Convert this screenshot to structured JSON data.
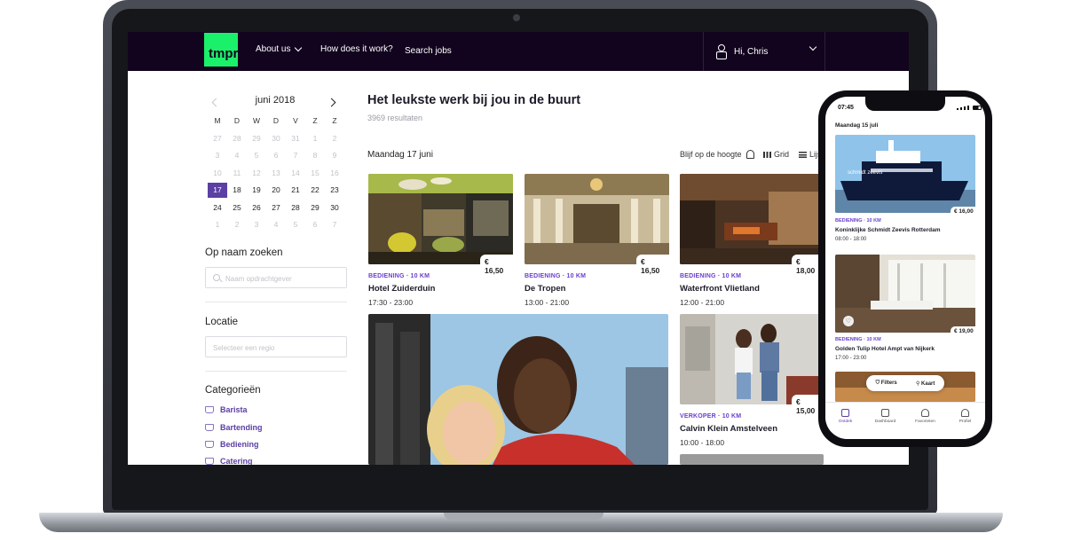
{
  "navbar": {
    "logo": "tmpr",
    "links": [
      {
        "label": "About us",
        "has_dropdown": true
      },
      {
        "label": "How does it work?",
        "has_dropdown": false
      },
      {
        "label": "Search jobs",
        "has_dropdown": false
      }
    ],
    "user_greeting": "Hi, Chris"
  },
  "calendar": {
    "month": "juni 2018",
    "weekdays": [
      "M",
      "D",
      "W",
      "D",
      "V",
      "Z",
      "Z"
    ],
    "rows": [
      [
        "27",
        "28",
        "29",
        "30",
        "31",
        "1",
        "2"
      ],
      [
        "3",
        "4",
        "5",
        "6",
        "7",
        "8",
        "9"
      ],
      [
        "10",
        "11",
        "12",
        "13",
        "14",
        "15",
        "16"
      ],
      [
        "17",
        "18",
        "19",
        "20",
        "21",
        "22",
        "23"
      ],
      [
        "24",
        "25",
        "26",
        "27",
        "28",
        "29",
        "30"
      ],
      [
        "1",
        "2",
        "3",
        "4",
        "5",
        "6",
        "7"
      ]
    ],
    "selected": "17"
  },
  "sidebar": {
    "name_search_title": "Op naam zoeken",
    "name_search_placeholder": "Naam opdrachtgever",
    "location_title": "Locatie",
    "location_placeholder": "Selecteer een regio",
    "categories_title": "Categorieën",
    "categories": [
      "Barista",
      "Bartending",
      "Bediening",
      "Catering"
    ]
  },
  "main": {
    "title": "Het leukste werk bij jou in de buurt",
    "result_count": "3969 resultaten",
    "date_heading": "Maandag 17 juni",
    "alert_label": "Blijf op de hoogte",
    "grid_label": "Grid",
    "list_label": "Lijst",
    "jobs": [
      {
        "category": "BEDIENING · 10 KM",
        "name": "Hotel Zuiderduin",
        "time": "17:30 - 23:00",
        "price": "€ 16,50"
      },
      {
        "category": "BEDIENING · 10 KM",
        "name": "De Tropen",
        "time": "13:00 - 21:00",
        "price": "€ 16,50"
      },
      {
        "category": "BEDIENING · 10 KM",
        "name": "Waterfront Vlietland",
        "time": "12:00 - 21:00",
        "price": "€ 18,00"
      },
      {
        "category": "VERKOPER · 10 KM",
        "name": "Calvin Klein Amstelveen",
        "time": "10:00 - 18:00",
        "price": "€ 15,00"
      }
    ]
  },
  "phone": {
    "time": "07:45",
    "date_heading": "Maandag 15 juli",
    "ship_name": "schmidt zeevis",
    "jobs": [
      {
        "price": "€ 16,00",
        "category": "BEDIENING · 10 KM",
        "name": "Koninklijke Schmidt Zeevis Rotterdam",
        "time": "08:00 - 18:00"
      },
      {
        "price": "€ 19,00",
        "category": "BEDIENING · 10 KM",
        "name": "Golden Tulip Hotel Ampt van Nijkerk",
        "time": "17:00 - 23:00"
      }
    ],
    "filters_label": "Filters",
    "map_label": "Kaart",
    "tabs": [
      {
        "label": "Ontdek",
        "icon": "discover-icon"
      },
      {
        "label": "Dashboard",
        "icon": "dashboard-icon"
      },
      {
        "label": "Favorieten",
        "icon": "heart-icon"
      },
      {
        "label": "Profiel",
        "icon": "person-icon"
      }
    ]
  },
  "colors": {
    "navbar_bg": "#12041f",
    "logo_green": "#1bf06a",
    "accent_purple": "#5b3fa3",
    "category_purple": "#6a3fd0"
  }
}
